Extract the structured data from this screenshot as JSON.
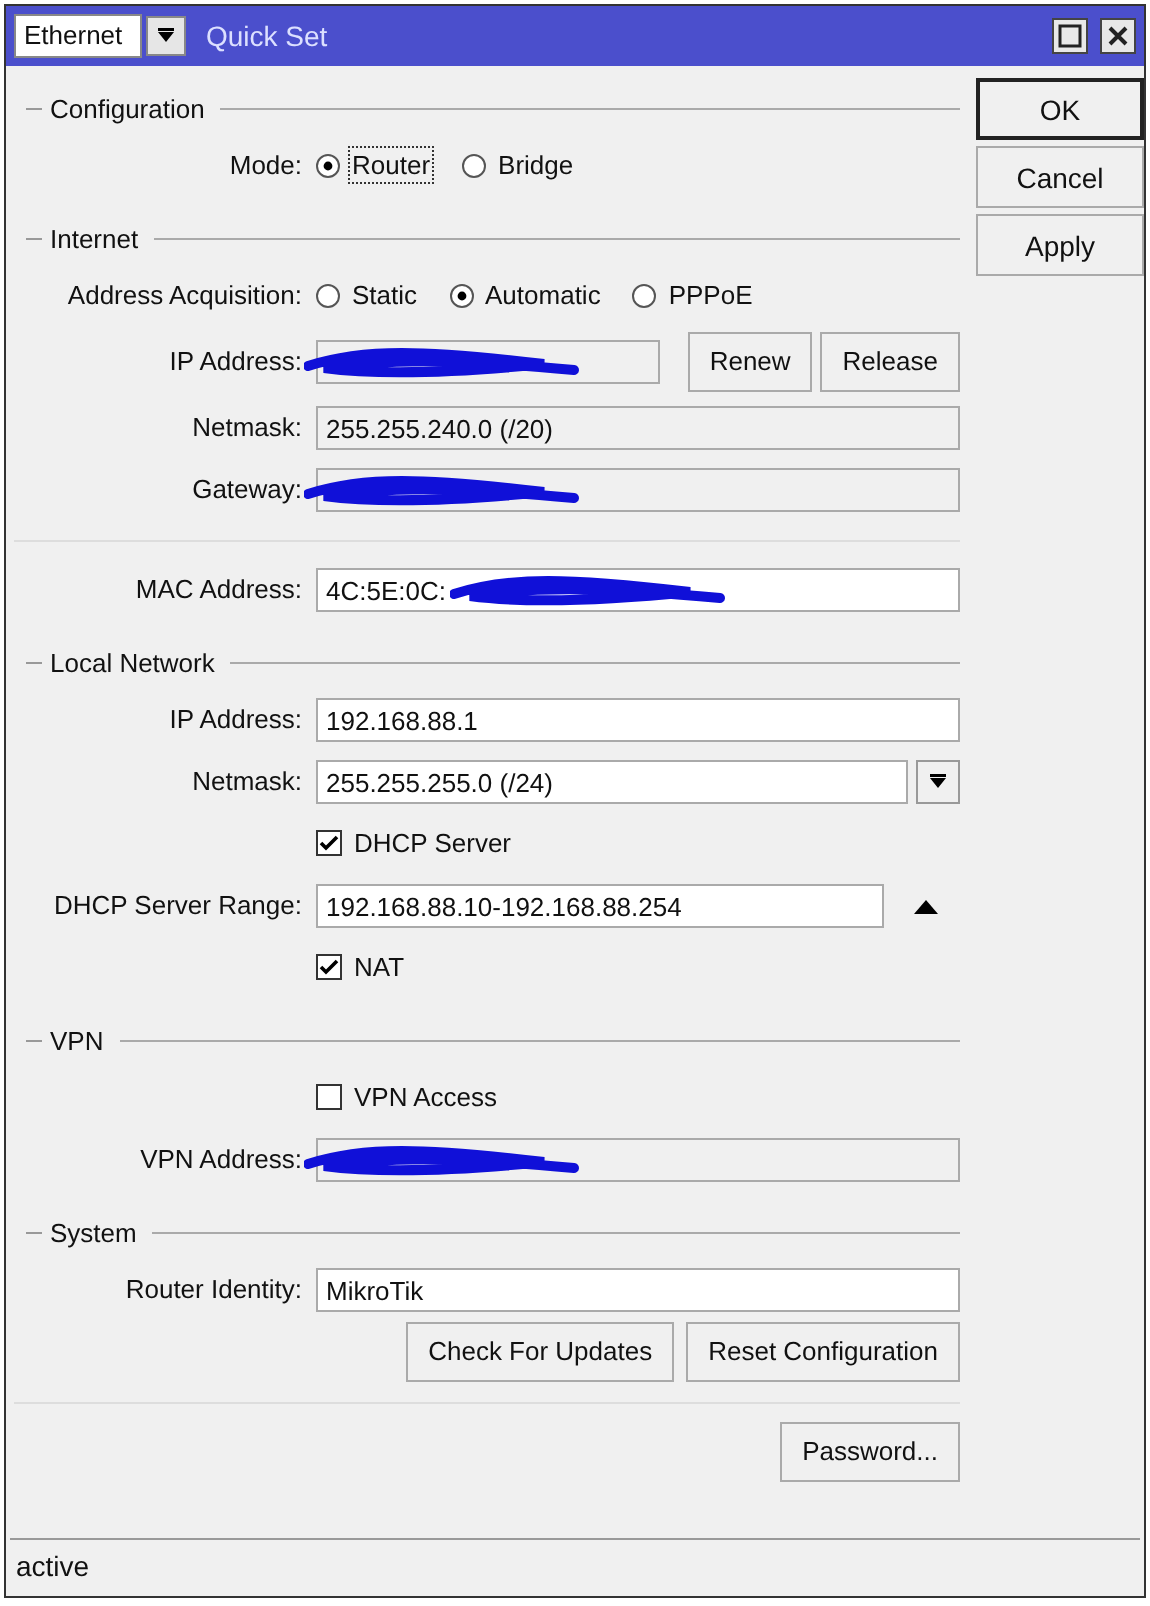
{
  "window": {
    "title": "Quick Set",
    "interface": "Ethernet"
  },
  "buttons": [
    {
      "label": "OK",
      "default": true
    },
    {
      "label": "Cancel",
      "default": false
    },
    {
      "label": "Apply",
      "default": false
    }
  ],
  "sections": [
    {
      "title": "Configuration",
      "rows": [
        {
          "kind": "radio",
          "label": "Mode:",
          "options": [
            {
              "label": "Router",
              "selected": true
            },
            {
              "label": "Bridge",
              "selected": false
            }
          ]
        }
      ]
    },
    {
      "title": "Internet",
      "rows": [
        {
          "kind": "radio",
          "label": "Address Acquisition:",
          "options": [
            {
              "label": "Static",
              "selected": false
            },
            {
              "label": "Automatic",
              "selected": true
            },
            {
              "label": "PPPoE",
              "selected": false
            }
          ]
        },
        {
          "kind": "field",
          "label": "IP Address:",
          "readonly": true,
          "redacted": true,
          "buttons": [
            "Renew",
            "Release"
          ]
        },
        {
          "kind": "field",
          "label": "Netmask:",
          "value": "255.255.240.0 (/20)",
          "readonly": true
        },
        {
          "kind": "field",
          "label": "Gateway:",
          "readonly": true,
          "redacted": true
        },
        {
          "kind": "separator"
        },
        {
          "kind": "field",
          "label": "MAC Address:",
          "value": "4C:5E:0C:",
          "readonly": false,
          "redacted": true
        }
      ]
    },
    {
      "title": "Local Network",
      "rows": [
        {
          "kind": "field",
          "label": "IP Address:",
          "value": "192.168.88.1",
          "readonly": false
        },
        {
          "kind": "field",
          "label": "Netmask:",
          "value": "255.255.255.0 (/24)",
          "readonly": false,
          "dropdown": true
        },
        {
          "kind": "checkbox",
          "label": "DHCP Server",
          "checked": true
        },
        {
          "kind": "field",
          "label": "DHCP Server Range:",
          "value": "192.168.88.10-192.168.88.254",
          "readonly": false,
          "expander": true
        },
        {
          "kind": "checkbox",
          "label": "NAT",
          "checked": true
        }
      ]
    },
    {
      "title": "VPN",
      "rows": [
        {
          "kind": "checkbox",
          "label": "VPN Access",
          "checked": false
        },
        {
          "kind": "field",
          "label": "VPN Address:",
          "readonly": true,
          "redacted": true
        }
      ]
    },
    {
      "title": "System",
      "rows": [
        {
          "kind": "field",
          "label": "Router Identity:",
          "value": "MikroTik",
          "readonly": false
        },
        {
          "kind": "buttons",
          "buttons": [
            "Check For Updates",
            "Reset Configuration"
          ]
        },
        {
          "kind": "separator"
        },
        {
          "kind": "buttons",
          "buttons": [
            "Password..."
          ]
        }
      ]
    }
  ],
  "status_bar": "active"
}
